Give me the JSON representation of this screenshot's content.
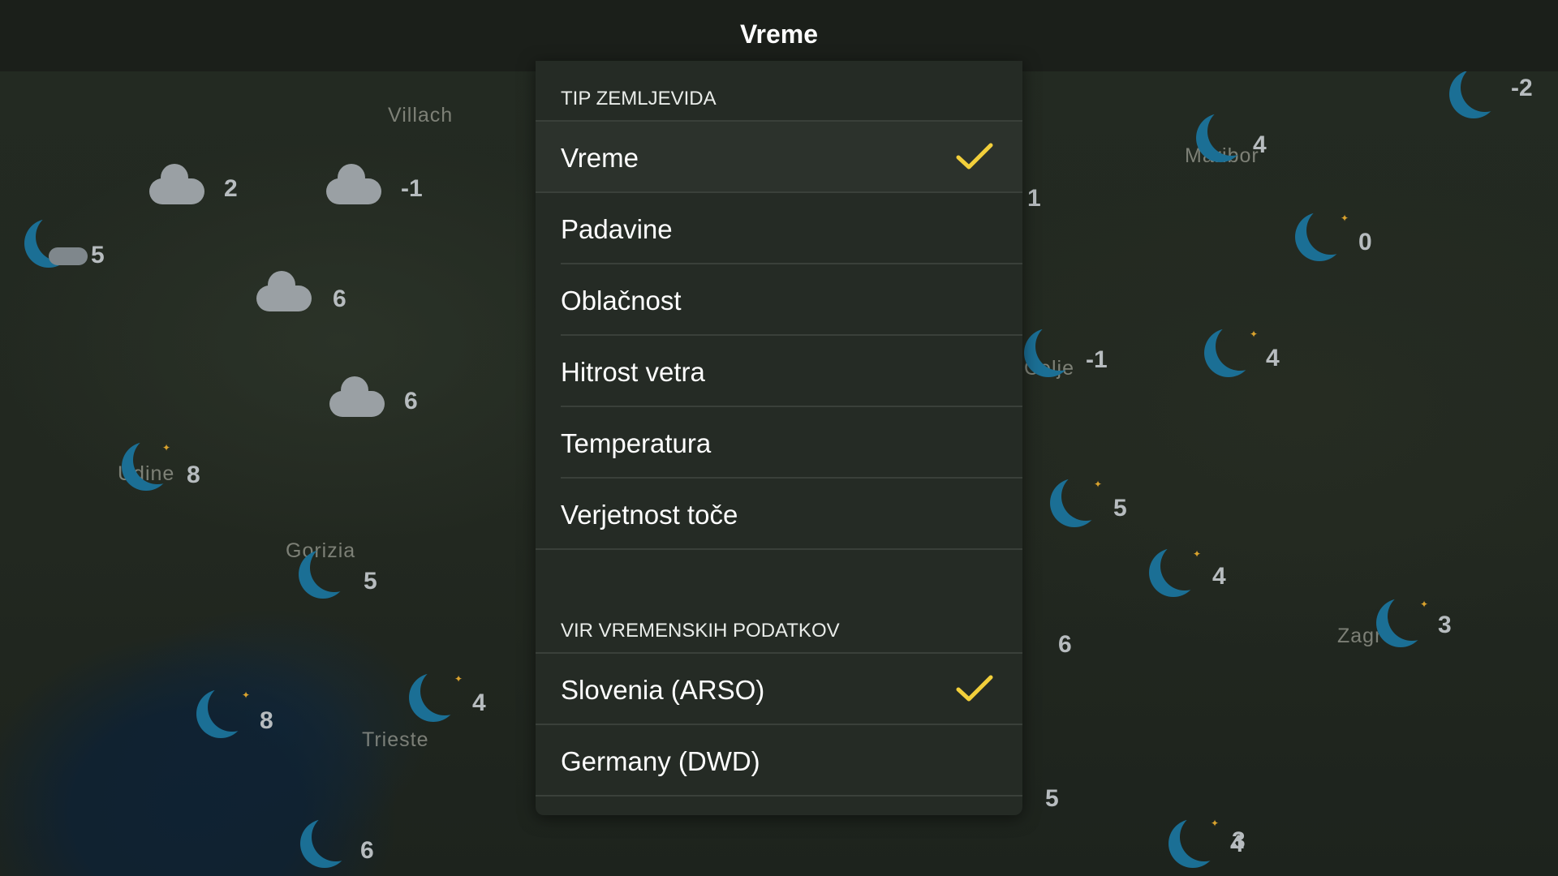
{
  "header": {
    "title": "Vreme"
  },
  "map": {
    "cities": [
      "Villach",
      "Gorizia",
      "Trieste",
      "Zagr",
      "Maribor",
      "Udine",
      "Celje"
    ],
    "temperatures": [
      "2",
      "-1",
      "5",
      "6",
      "6",
      "8",
      "5",
      "8",
      "4",
      "6",
      "1",
      "-1",
      "5",
      "4",
      "6",
      "5",
      "4",
      "0",
      "4",
      "-2",
      "4",
      "3",
      "3"
    ]
  },
  "panel": {
    "map_type_header": "TIP ZEMLJEVIDA",
    "map_types": [
      {
        "label": "Vreme",
        "selected": true
      },
      {
        "label": "Padavine",
        "selected": false
      },
      {
        "label": "Oblačnost",
        "selected": false
      },
      {
        "label": "Hitrost vetra",
        "selected": false
      },
      {
        "label": "Temperatura",
        "selected": false
      },
      {
        "label": "Verjetnost toče",
        "selected": false
      }
    ],
    "source_header": "VIR VREMENSKIH PODATKOV",
    "sources": [
      {
        "label": "Slovenia (ARSO)",
        "selected": true
      },
      {
        "label": "Germany (DWD)",
        "selected": false
      }
    ]
  },
  "colors": {
    "accent_check": "#f2cf3b",
    "moon": "#1b6f95",
    "background": "#1b1f1a"
  },
  "icons": [
    "checkmark-icon",
    "moon-icon",
    "cloud-icon"
  ]
}
